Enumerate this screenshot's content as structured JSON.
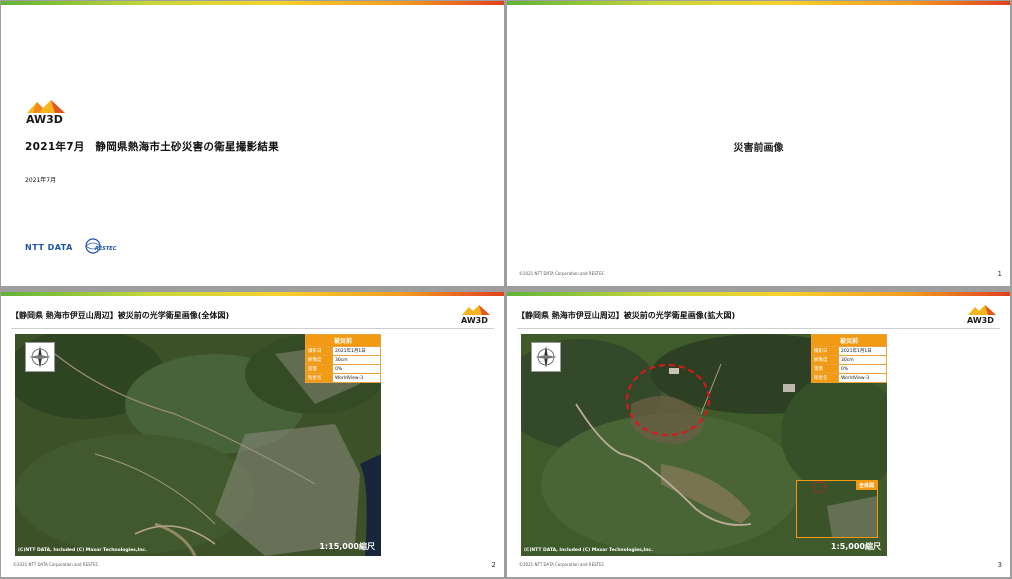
{
  "slide1": {
    "logo_text": "AW3D",
    "title": "2021年7月　静岡県熱海市土砂災害の衛星撮影結果",
    "date": "2021年7月",
    "ntt_logo": "NTT DATA",
    "restec_logo": "RESTEC"
  },
  "slide2": {
    "center_title": "災害前画像",
    "copyright": "©2021 NTT DATA Corporation and RESTEC",
    "page_number": "1"
  },
  "slide3": {
    "heading": "【静岡県 熱海市伊豆山周辺】被災前の光学衛星画像(全体図)",
    "logo_text": "AW3D",
    "info": {
      "header": "被災前",
      "rows": [
        {
          "key": "撮影日",
          "value": "2021年1月1日"
        },
        {
          "key": "解像度",
          "value": "30cm"
        },
        {
          "key": "雲量",
          "value": "0%"
        },
        {
          "key": "衛星名",
          "value": "WorldView-3"
        }
      ]
    },
    "credit": "(C)NTT DATA, Included (C) Maxar Technologies,Inc.",
    "scale": "1:15,000縮尺",
    "copyright": "©2021 NTT DATA Corporation and RESTEC",
    "page_number": "2"
  },
  "slide4": {
    "heading": "【静岡県 熱海市伊豆山周辺】被災前の光学衛星画像(拡大図)",
    "logo_text": "AW3D",
    "info": {
      "header": "被災前",
      "rows": [
        {
          "key": "撮影日",
          "value": "2021年1月1日"
        },
        {
          "key": "解像度",
          "value": "30cm"
        },
        {
          "key": "雲量",
          "value": "0%"
        },
        {
          "key": "衛星名",
          "value": "WorldView-3"
        }
      ]
    },
    "inset_label": "全体図",
    "credit": "(C)NTT DATA, Included (C) Maxar Technologies,Inc.",
    "scale": "1:5,000縮尺",
    "copyright": "©2021 NTT DATA Corporation and RESTEC",
    "page_number": "3"
  },
  "colors": {
    "accent_orange": "#f29a12",
    "annotation_red": "#e0161b",
    "ntt_blue": "#1a55a6"
  }
}
